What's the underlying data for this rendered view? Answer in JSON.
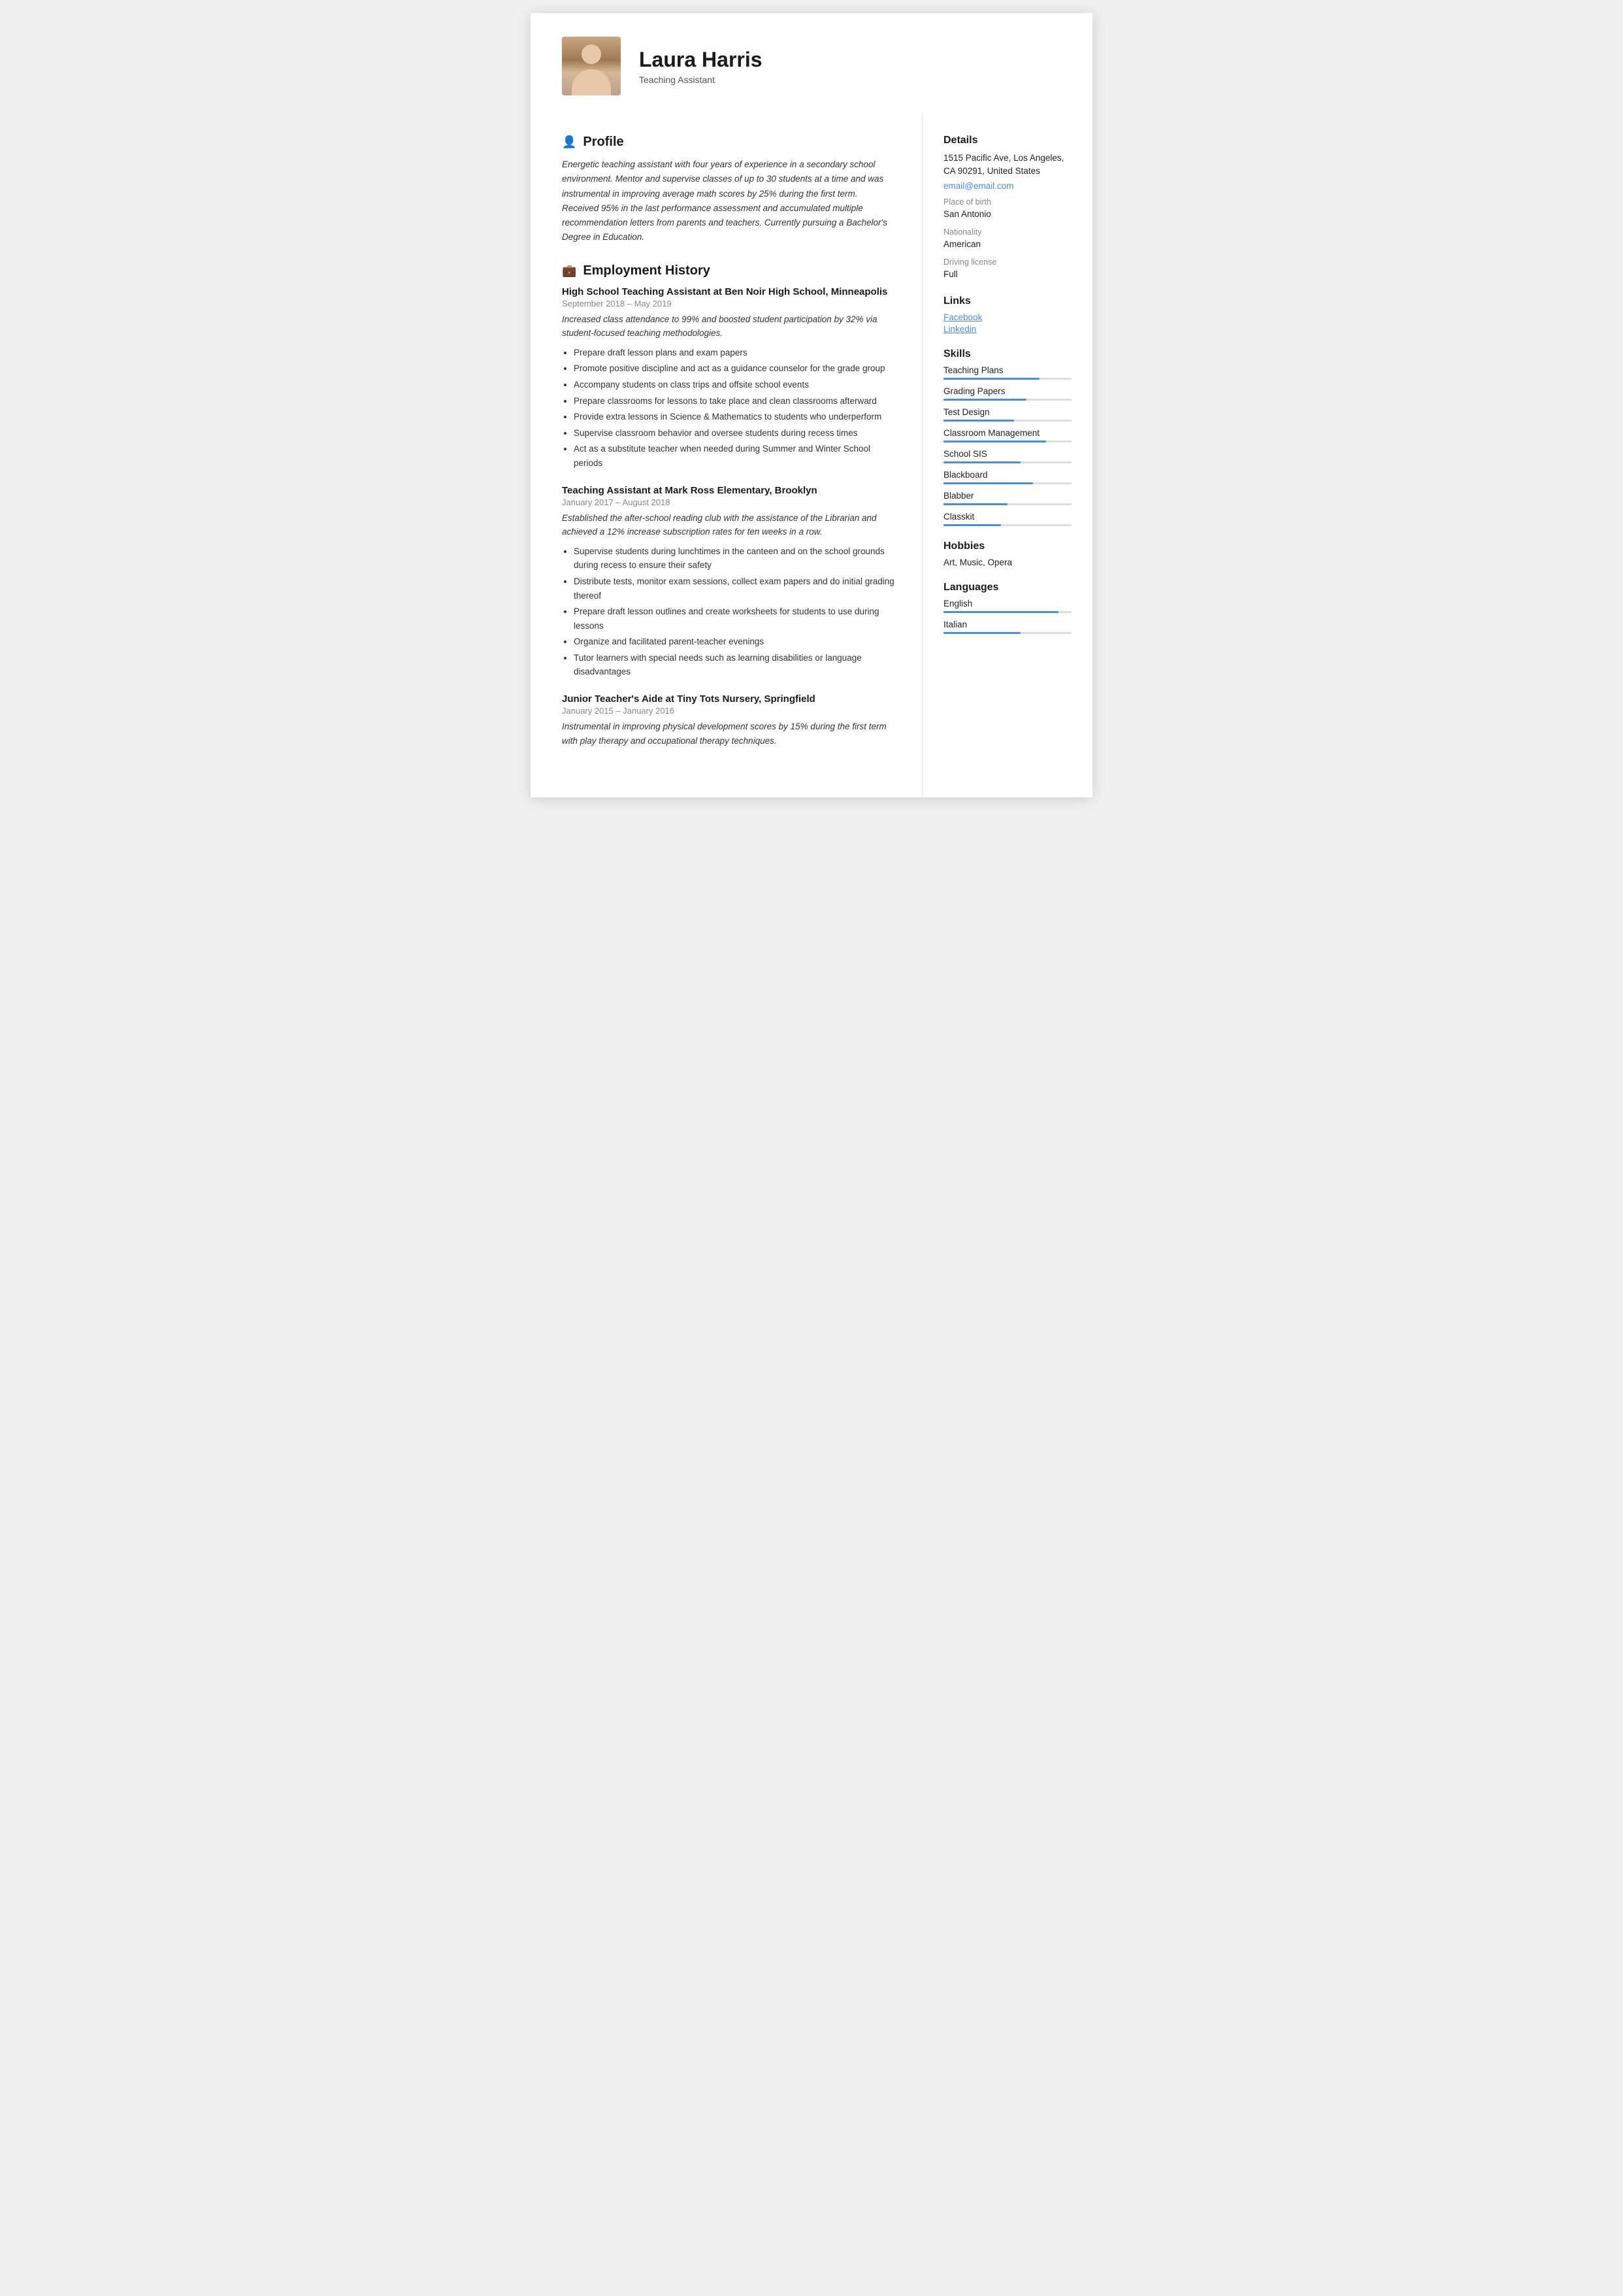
{
  "header": {
    "name": "Laura Harris",
    "title": "Teaching Assistant"
  },
  "profile": {
    "heading": "Profile",
    "text": "Energetic teaching assistant with four years of experience in a secondary school environment. Mentor and supervise classes of up to 30 students at a time and was instrumental in improving average math scores by 25% during the first term. Received 95% in the last performance assessment and accumulated multiple recommendation letters from parents and teachers. Currently pursuing a Bachelor's Degree in Education."
  },
  "employment": {
    "heading": "Employment History",
    "jobs": [
      {
        "title": "High School Teaching Assistant at Ben Noir High School, Minneapolis",
        "dates": "September 2018  –  May 2019",
        "description": "Increased class attendance to 99% and boosted student participation by 32% via student-focused teaching methodologies.",
        "bullets": [
          "Prepare draft lesson plans and exam papers",
          "Promote positive discipline and act as a guidance counselor for the grade group",
          "Accompany students on class trips and offsite school events",
          "Prepare classrooms for lessons to take place and clean classrooms afterward",
          "Provide extra lessons in Science & Mathematics to students who underperform",
          "Supervise classroom behavior and oversee students during recess times",
          "Act as a substitute teacher when needed during Summer and Winter School periods"
        ]
      },
      {
        "title": "Teaching Assistant at Mark Ross Elementary, Brooklyn",
        "dates": "January 2017  –  August 2018",
        "description": "Established the after-school reading club with the assistance of the Librarian and achieved a 12% increase subscription rates for ten weeks in a row.",
        "bullets": [
          "Supervise students during lunchtimes in the canteen and on the school grounds during recess to ensure their safety",
          "Distribute tests, monitor exam sessions, collect exam papers and do initial grading thereof",
          "Prepare draft lesson outlines and create worksheets for students to use during lessons",
          "Organize and facilitated parent-teacher evenings",
          "Tutor learners with special needs such as learning disabilities or language disadvantages"
        ]
      },
      {
        "title": "Junior Teacher's Aide at Tiny Tots Nursery, Springfield",
        "dates": "January 2015  –  January 2016",
        "description": "Instrumental in improving physical development scores by 15% during the first term with play therapy and occupational therapy techniques.",
        "bullets": []
      }
    ]
  },
  "details": {
    "heading": "Details",
    "address": "1515 Pacific Ave, Los Angeles, CA 90291, United States",
    "email": "email@email.com",
    "place_of_birth_label": "Place of birth",
    "place_of_birth": "San Antonio",
    "nationality_label": "Nationality",
    "nationality": "American",
    "driving_license_label": "Driving license",
    "driving_license": "Full"
  },
  "links": {
    "heading": "Links",
    "items": [
      {
        "label": "Facebook",
        "url": "#"
      },
      {
        "label": "Linkedin",
        "url": "#"
      }
    ]
  },
  "skills": {
    "heading": "Skills",
    "items": [
      {
        "name": "Teaching Plans",
        "level": 75
      },
      {
        "name": "Grading Papers",
        "level": 65
      },
      {
        "name": "Test Design",
        "level": 55
      },
      {
        "name": "Classroom Management",
        "level": 80
      },
      {
        "name": "School SIS",
        "level": 60
      },
      {
        "name": "Blackboard",
        "level": 70
      },
      {
        "name": "Blabber",
        "level": 50
      },
      {
        "name": "Classkit",
        "level": 45
      }
    ]
  },
  "hobbies": {
    "heading": "Hobbies",
    "text": "Art, Music, Opera"
  },
  "languages": {
    "heading": "Languages",
    "items": [
      {
        "name": "English",
        "level": 90
      },
      {
        "name": "Italian",
        "level": 60
      }
    ]
  }
}
